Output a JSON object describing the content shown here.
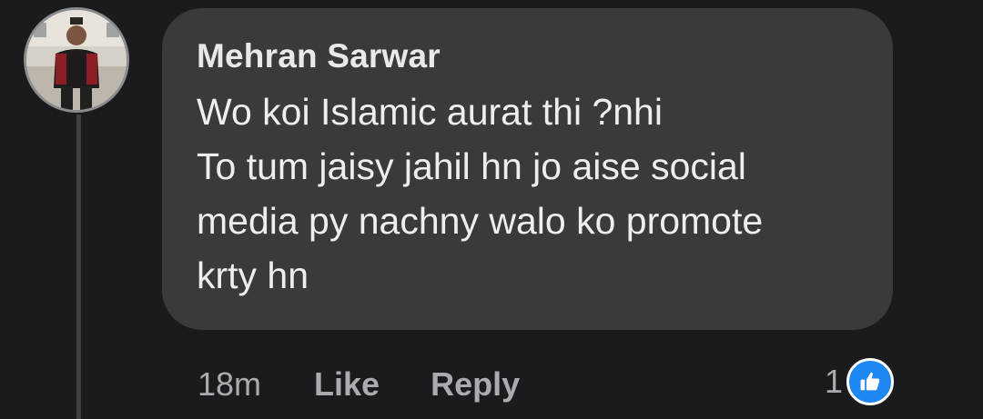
{
  "comment": {
    "author": "Mehran Sarwar",
    "lines": [
      "Wo koi Islamic aurat thi ?nhi",
      "To tum jaisy jahil hn jo aise social",
      "media py nachny walo ko promote",
      "krty hn"
    ],
    "timestamp": "18m",
    "like_label": "Like",
    "reply_label": "Reply",
    "reaction_count": "1",
    "reaction_icon": "thumbs-up-icon"
  },
  "colors": {
    "background": "#1b1b1d",
    "bubble": "#3a3a3c",
    "reaction_blue": "#1d88f2",
    "muted_text": "#a9abb0"
  }
}
